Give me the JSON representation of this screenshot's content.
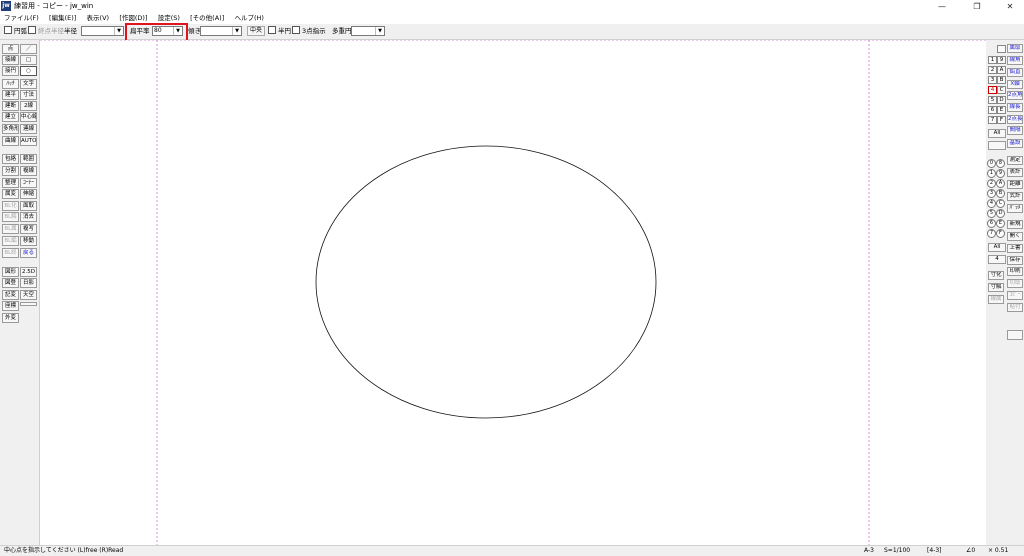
{
  "window": {
    "title": "練習用 - コピー - jw_win",
    "icon_label": "jw",
    "controls": [
      "—",
      "❐",
      "✕"
    ]
  },
  "menu": [
    "ファイル(F)",
    "[編集(E)]",
    "表示(V)",
    "[作図(D)]",
    "設定(S)",
    "[その他(A)]",
    "ヘルプ(H)"
  ],
  "toolbar": {
    "circle_arc_label": "円弧",
    "end_radius_label": "終点半径",
    "radius_label": "半径",
    "radius_value": "",
    "flatness_label": "扁平率",
    "flatness_value": "80",
    "tilt_label": "傾き",
    "tilt_value": "",
    "center_button": "中央",
    "half_circle_label": "半円",
    "three_point_label": "3点指示",
    "polygon_label": "多重円",
    "polygon_value": ""
  },
  "left_tools": [
    [
      "点",
      "／"
    ],
    [
      "接線",
      "□"
    ],
    [
      "接円",
      "○"
    ],
    [
      "ﾊｯﾁ",
      "文字"
    ],
    [
      "建平",
      "寸法"
    ],
    [
      "建断",
      "2線"
    ],
    [
      "建立",
      "中心線"
    ],
    [
      "多角形",
      "連線"
    ],
    [
      "曲線",
      "AUTO"
    ],
    [
      "包絡",
      "範囲"
    ],
    [
      "分割",
      "複線"
    ],
    [
      "整理",
      "ｺｰﾅｰ"
    ],
    [
      "属変",
      "伸縮"
    ],
    [
      "BL化",
      "面取"
    ],
    [
      "BL解",
      "消去"
    ],
    [
      "BL属",
      "複写"
    ],
    [
      "BL編",
      "移動"
    ],
    [
      "BL終",
      "戻る"
    ],
    [
      "図形",
      "2.5D"
    ],
    [
      "図登",
      "日影"
    ],
    [
      "記変",
      "天空"
    ],
    [
      "座標",
      ""
    ],
    [
      "外変",
      ""
    ]
  ],
  "layer_numbers": [
    "1",
    "2",
    "3",
    "4",
    "5",
    "6",
    "7"
  ],
  "layer_letters": [
    "9",
    "A",
    "B",
    "C",
    "D",
    "E",
    "F"
  ],
  "layer_all": "All",
  "right_tools_a": [
    "属取",
    "線角",
    "鉛直",
    "X軸",
    "2点角",
    "線長",
    "2点長",
    "間隔",
    "基設"
  ],
  "right_circles": [
    "0",
    "8",
    "1",
    "9",
    "2",
    "A",
    "3",
    "B",
    "4",
    "C",
    "5",
    "D",
    "6",
    "E",
    "7",
    "F"
  ],
  "right_tools_b": [
    "測定",
    "表計",
    "距離",
    "式計",
    "ﾊﾟﾗﾒ"
  ],
  "right_tools_c": [
    "新規",
    "開く",
    "上書",
    "保存"
  ],
  "right_tools_d": [
    "印刷",
    "切取",
    "ｺﾋﾟｰ",
    "貼付"
  ],
  "right_tools_e": [
    "寸化",
    "寸解",
    "線属"
  ],
  "right_all": "All",
  "right_four": "4",
  "status": {
    "message": "中心点を指示してください (L)free (R)Read",
    "paper": "A-3",
    "scale": "S=1/100",
    "layer": "[4-3]",
    "angle": "∠0",
    "zoom": "× 0.51"
  },
  "colors": {
    "highlight": "#e0141e",
    "guide_line": "#d070d0"
  }
}
